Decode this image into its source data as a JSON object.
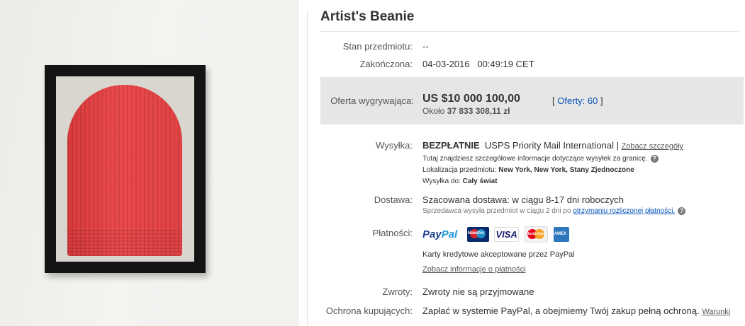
{
  "item": {
    "title": "Artist's Beanie"
  },
  "details": {
    "condition_label": "Stan przedmiotu:",
    "condition_value": "--",
    "ended_label": "Zakończona:",
    "ended_date": "04-03-2016",
    "ended_time": "00:49:19 CET"
  },
  "bid": {
    "label": "Oferta wygrywająca:",
    "price": "US $10 000 100,00",
    "approx_prefix": "Około",
    "approx_value": "37 833 308,11 zł",
    "bids_open": "[",
    "bids_link": "Oferty: 60",
    "bids_close": "]"
  },
  "shipping": {
    "label": "Wysyłka:",
    "free": "BEZPŁATNIE",
    "service": "USPS Priority Mail International |",
    "details_link": "Zobacz szczegóły",
    "info": "Tutaj znajdziesz szczegółowe informacje dotyczące wysyłek za granicę.",
    "location_label": "Lokalizacja przedmiotu:",
    "location_value": "New York, New York, Stany Zjednoczone",
    "ships_to_label": "Wysyłka do:",
    "ships_to_value": "Cały świat"
  },
  "delivery": {
    "label": "Dostawa:",
    "estimate": "Szacowana dostawa: w ciągu 8-17 dni roboczych",
    "note": "Sprzedawca wysyła przedmiot w ciągu 2 dni po",
    "note_link": "otrzymaniu rozliczonej płatności."
  },
  "payments": {
    "label": "Płatności:",
    "paypal_part1": "Pay",
    "paypal_part2": "Pal",
    "maestro": "Maestro",
    "visa": "VISA",
    "mastercard": "MasterCard",
    "amex": "AMEX",
    "accepted": "Karty kredytowe akceptowane przez PayPal",
    "info_link": "Zobacz informacje o płatności"
  },
  "returns": {
    "label": "Zwroty:",
    "value": "Zwroty nie są przyjmowane"
  },
  "protection": {
    "label": "Ochrona kupujących:",
    "value": "Zapłać w systemie PayPal, a obejmiemy Twój zakup pełną ochroną.",
    "link": "Warunki"
  },
  "colors": {
    "link": "#0654ba",
    "bid_bg": "#e6e6e6",
    "beanie_red": "#e4403f"
  }
}
